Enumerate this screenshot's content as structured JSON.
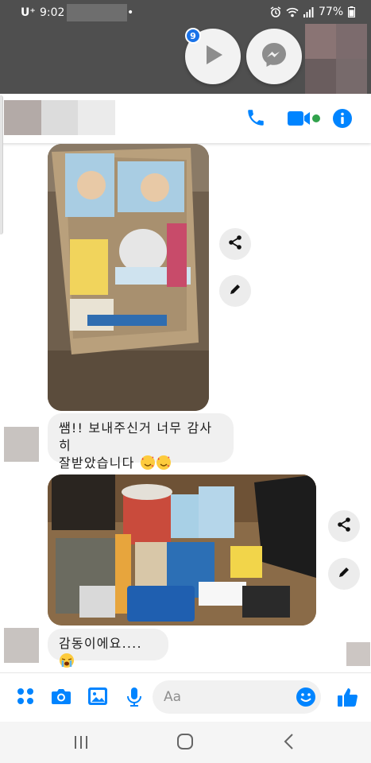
{
  "status_bar": {
    "carrier": "U⁺",
    "time": "9:02",
    "dot": "•",
    "battery": "77%"
  },
  "bubbles": {
    "badge_count": "9"
  },
  "messages": [
    {
      "type": "photo",
      "id": "photo-1"
    },
    {
      "type": "text",
      "lines": [
        "쌤!! 보내주신거 너무 감사히",
        "잘받았습니다"
      ]
    },
    {
      "type": "photo",
      "id": "photo-2"
    },
    {
      "type": "text",
      "lines": [
        "감동이에요...."
      ]
    }
  ],
  "compose": {
    "placeholder": "Aa"
  },
  "colors": {
    "accent": "#0084ff",
    "bubble_bg": "#f0f0f0",
    "online": "#31a24c"
  },
  "icons": {
    "header": [
      "phone-icon",
      "video-icon",
      "info-icon"
    ],
    "compose": [
      "apps-icon",
      "camera-icon",
      "gallery-icon",
      "mic-icon",
      "emoji-icon",
      "like-icon"
    ],
    "nav": [
      "recents-icon",
      "home-icon",
      "back-icon"
    ]
  }
}
